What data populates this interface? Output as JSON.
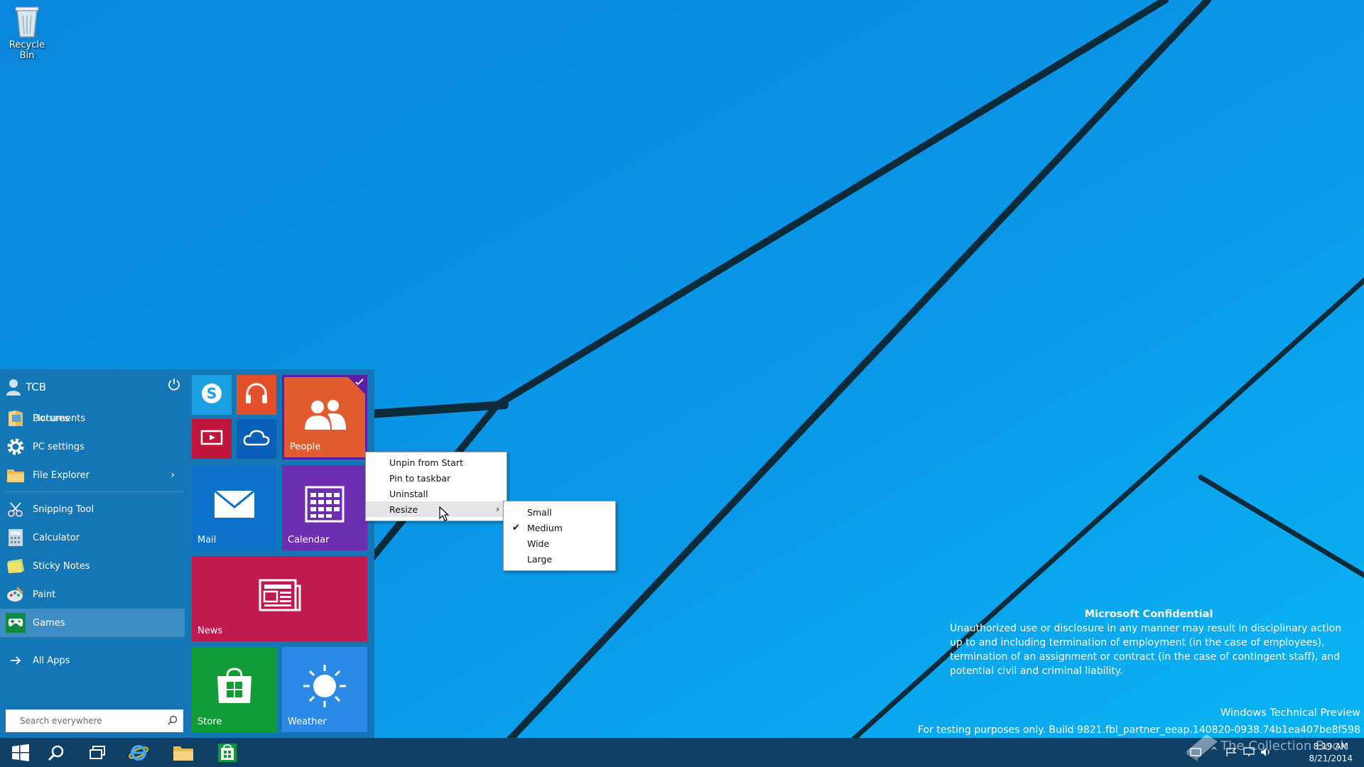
{
  "desktop": {
    "recycle_bin_label": "Recycle Bin"
  },
  "start_menu": {
    "user_name": "TCB",
    "items": [
      {
        "label": "Documents"
      },
      {
        "label": "Pictures"
      },
      {
        "label": "PC settings"
      },
      {
        "label": "File Explorer"
      },
      {
        "label": "Snipping Tool"
      },
      {
        "label": "Calculator"
      },
      {
        "label": "Sticky Notes"
      },
      {
        "label": "Paint"
      },
      {
        "label": "Games"
      }
    ],
    "all_apps": "All Apps",
    "search_placeholder": "Search everywhere",
    "tiles": {
      "people": "People",
      "mail": "Mail",
      "calendar": "Calendar",
      "news": "News",
      "store": "Store",
      "weather": "Weather"
    },
    "colors": {
      "menu_bg": "#1476b5",
      "skype": "#1ba1e2",
      "music": "#e4502b",
      "people": "#e05c2f",
      "video": "#c1163c",
      "onedrive": "#0a5fb8",
      "mail": "#0a73c9",
      "calendar": "#6d2fb0",
      "news": "#c01a4f",
      "store": "#109b35",
      "weather": "#2c8ae6"
    }
  },
  "context_menu": {
    "items": [
      {
        "label": "Unpin from Start"
      },
      {
        "label": "Pin to taskbar"
      },
      {
        "label": "Uninstall"
      },
      {
        "label": "Resize"
      }
    ],
    "resize_submenu": [
      {
        "label": "Small",
        "checked": false
      },
      {
        "label": "Medium",
        "checked": true
      },
      {
        "label": "Wide",
        "checked": false
      },
      {
        "label": "Large",
        "checked": false
      }
    ]
  },
  "watermark": {
    "heading": "Microsoft Confidential",
    "body": "Unauthorized use or disclosure in any manner may result in disciplinary action up to and including termination of employment (in the case of employees), termination of an assignment or contract (in the case of contingent staff), and potential civil and criminal liability.",
    "edition": "Windows Technical Preview",
    "build": "For testing purposes only. Build 9821.fbl_partner_eeap.140820-0938.74b1ea407be8f598"
  },
  "taskbar": {
    "clock_time": "8:19 AM",
    "clock_date": "8/21/2014",
    "brand_overlay": "The Collection Book"
  }
}
